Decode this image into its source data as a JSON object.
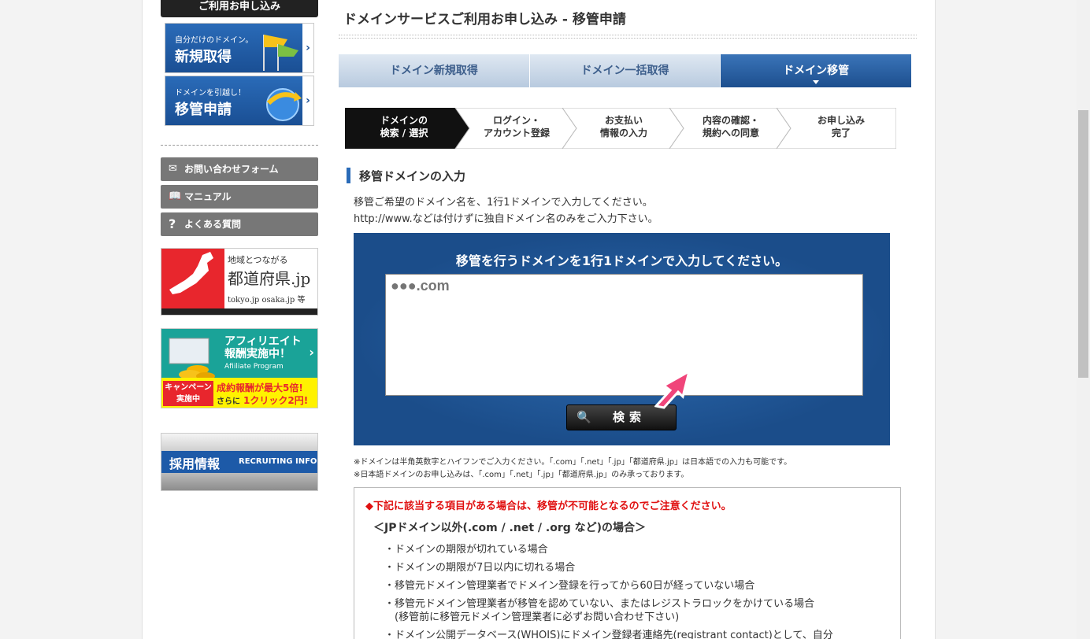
{
  "sidebar": {
    "header": "ご利用お申し込み",
    "promo_new": {
      "small": "自分だけのドメイン。",
      "large": "新規取得"
    },
    "promo_transfer": {
      "small": "ドメインを引越し！",
      "large": "移管申請"
    },
    "links": [
      {
        "label": "お問い合わせフォーム",
        "icon": "mail-icon"
      },
      {
        "label": "マニュアル",
        "icon": "book-icon"
      },
      {
        "label": "よくある質問",
        "icon": "question-icon"
      }
    ],
    "pref_banner": {
      "line1": "地域とつながる",
      "line2": "都道府県.jp",
      "line3": "tokyo.jp osaka.jp 等"
    },
    "affiliate_banner": {
      "title1": "アフィリエイト",
      "title2": "報酬実施中！",
      "en": "Afiiliate Program",
      "campaign": "キャンペーン実施中",
      "reward1": "成約報酬が最大5倍!",
      "reward2_pre": "さらに",
      "reward2": "1クリック2円!"
    },
    "recruit_banner": {
      "jp": "採用情報",
      "en": "RECRUITING INFO"
    }
  },
  "main": {
    "title": "ドメインサービスご利用お申し込み - 移管申請",
    "tabs": [
      {
        "label": "ドメイン新規取得",
        "active": false
      },
      {
        "label": "ドメイン一括取得",
        "active": false
      },
      {
        "label": "ドメイン移管",
        "active": true
      }
    ],
    "steps": [
      {
        "line1": "ドメインの",
        "line2": "検索 / 選択",
        "active": true
      },
      {
        "line1": "ログイン・",
        "line2": "アカウント登録",
        "active": false
      },
      {
        "line1": "お支払い",
        "line2": "情報の入力",
        "active": false
      },
      {
        "line1": "内容の確認・",
        "line2": "規約への同意",
        "active": false
      },
      {
        "line1": "お申し込み",
        "line2": "完了",
        "active": false
      }
    ],
    "section_title": "移管ドメインの入力",
    "desc1": "移管ご希望のドメイン名を、1行1ドメインで入力してください。",
    "desc2": "http://www.などは付けずに独自ドメイン名のみをご入力下さい。",
    "input_header": "移管を行うドメインを1行1ドメインで入力してください。",
    "textarea_placeholder": "●●●.com",
    "search_label": "検索",
    "note1": "※ドメインは半角英数字とハイフンでご入力ください。「.com」「.net」「.jp」「都道府県.jp」は日本語での入力も可能です。",
    "note2": "※日本語ドメインのお申し込みは、「.com」「.net」「.jp」「都道府県.jp」のみ承っております。",
    "warning": {
      "title": "◆下記に該当する項目がある場合は、移管が不可能となるのでご注意ください。",
      "subtitle": "＜JPドメイン以外(.com / .net / .org など)の場合＞",
      "items": [
        "・ドメインの期限が切れている場合",
        "・ドメインの期限が7日以内に切れる場合",
        "・移管元ドメイン管理業者でドメイン登録を行ってから60日が経っていない場合",
        "・移管元ドメイン管理業者が移管を認めていない、またはレジストラロックをかけている場合",
        "　(移管前に移管元ドメイン管理業者に必ずお問い合わせ下さい)",
        "・ドメイン公開データベース(WHOIS)にドメイン登録者連絡先(registrant contact)として、自分"
      ]
    }
  },
  "colors": {
    "accent": "#1d4f8f",
    "warning": "#e01010",
    "placeholder": "#e8366a"
  }
}
